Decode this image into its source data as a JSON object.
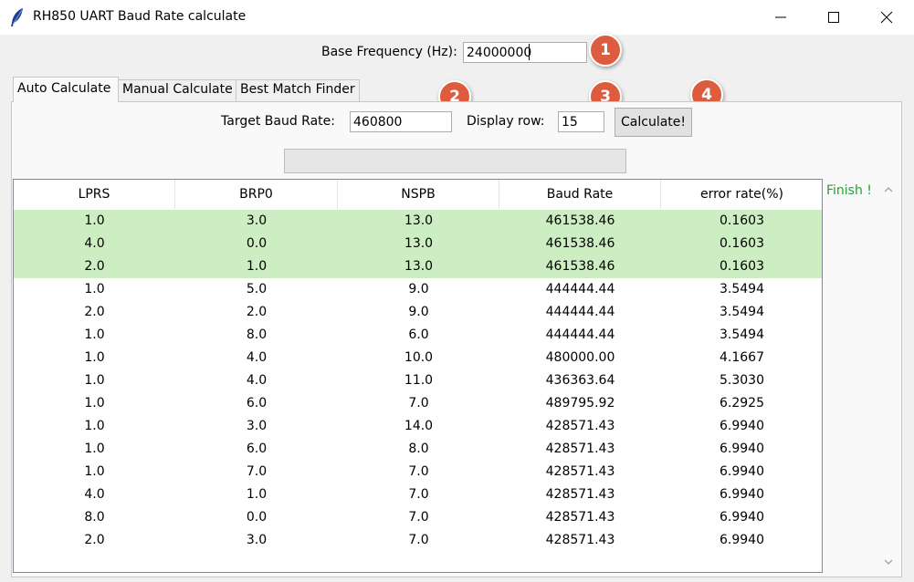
{
  "window": {
    "title": "RH850 UART Baud Rate calculate",
    "icon": "feather-icon",
    "controls": [
      "minimize-icon",
      "maximize-icon",
      "close-icon"
    ]
  },
  "base_frequency": {
    "label": "Base Frequency (Hz):",
    "value": "24000000"
  },
  "tabs": [
    {
      "label": "Auto Calculate",
      "active": true
    },
    {
      "label": "Manual Calculate",
      "active": false
    },
    {
      "label": "Best Match Finder",
      "active": false
    }
  ],
  "auto": {
    "target_label": "Target Baud Rate:",
    "target_value": "460800",
    "display_row_label": "Display row:",
    "display_row_value": "15",
    "calculate_label": "Calculate!",
    "progress": 0,
    "status": "Finish !"
  },
  "badges": [
    "1",
    "2",
    "3",
    "4"
  ],
  "table": {
    "columns": [
      "LPRS",
      "BRP0",
      "NSPB",
      "Baud Rate",
      "error rate(%)"
    ],
    "rows": [
      [
        "1.0",
        "3.0",
        "13.0",
        "461538.46",
        "0.1603"
      ],
      [
        "4.0",
        "0.0",
        "13.0",
        "461538.46",
        "0.1603"
      ],
      [
        "2.0",
        "1.0",
        "13.0",
        "461538.46",
        "0.1603"
      ],
      [
        "1.0",
        "5.0",
        "9.0",
        "444444.44",
        "3.5494"
      ],
      [
        "2.0",
        "2.0",
        "9.0",
        "444444.44",
        "3.5494"
      ],
      [
        "1.0",
        "8.0",
        "6.0",
        "444444.44",
        "3.5494"
      ],
      [
        "1.0",
        "4.0",
        "10.0",
        "480000.00",
        "4.1667"
      ],
      [
        "1.0",
        "4.0",
        "11.0",
        "436363.64",
        "5.3030"
      ],
      [
        "1.0",
        "6.0",
        "7.0",
        "489795.92",
        "6.2925"
      ],
      [
        "1.0",
        "3.0",
        "14.0",
        "428571.43",
        "6.9940"
      ],
      [
        "1.0",
        "6.0",
        "8.0",
        "428571.43",
        "6.9940"
      ],
      [
        "1.0",
        "7.0",
        "7.0",
        "428571.43",
        "6.9940"
      ],
      [
        "4.0",
        "1.0",
        "7.0",
        "428571.43",
        "6.9940"
      ],
      [
        "8.0",
        "0.0",
        "7.0",
        "428571.43",
        "6.9940"
      ],
      [
        "2.0",
        "3.0",
        "7.0",
        "428571.43",
        "6.9940"
      ]
    ],
    "highlighted_rows": [
      0,
      1,
      2
    ],
    "highlight_color": "#cdeec3"
  },
  "colors": {
    "badge": "#dd5c3e",
    "status": "#2a9d36"
  }
}
